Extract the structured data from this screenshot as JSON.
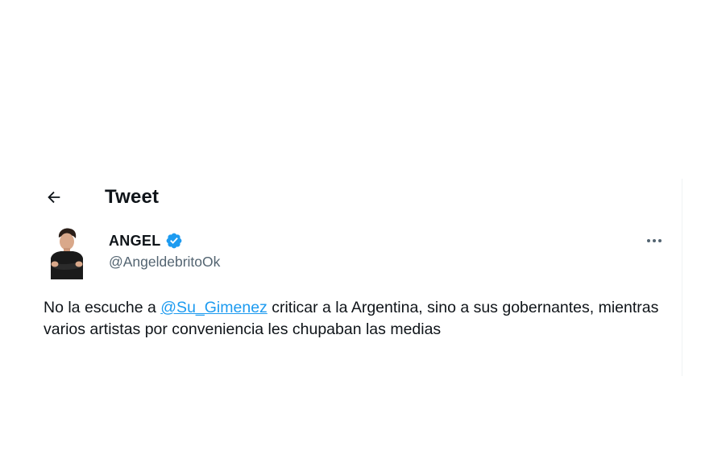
{
  "header": {
    "title": "Tweet",
    "back_icon": "arrow-left-icon"
  },
  "tweet": {
    "author": {
      "display_name": "ANGEL",
      "handle": "@AngeldebritoOk",
      "verified": true,
      "verified_icon": "verified-badge-icon",
      "verified_color": "#1d9bf0"
    },
    "more_icon": "more-horizontal-icon",
    "text": {
      "before_mention": "No la escuche a ",
      "mention": "@Su_Gimenez",
      "after_mention": " criticar a la Argentina, sino a sus gobernantes, mientras varios artistas por conveniencia les chupaban las medias"
    }
  },
  "colors": {
    "text_primary": "#0f1419",
    "text_secondary": "#536471",
    "link": "#1d9bf0",
    "background": "#ffffff"
  }
}
